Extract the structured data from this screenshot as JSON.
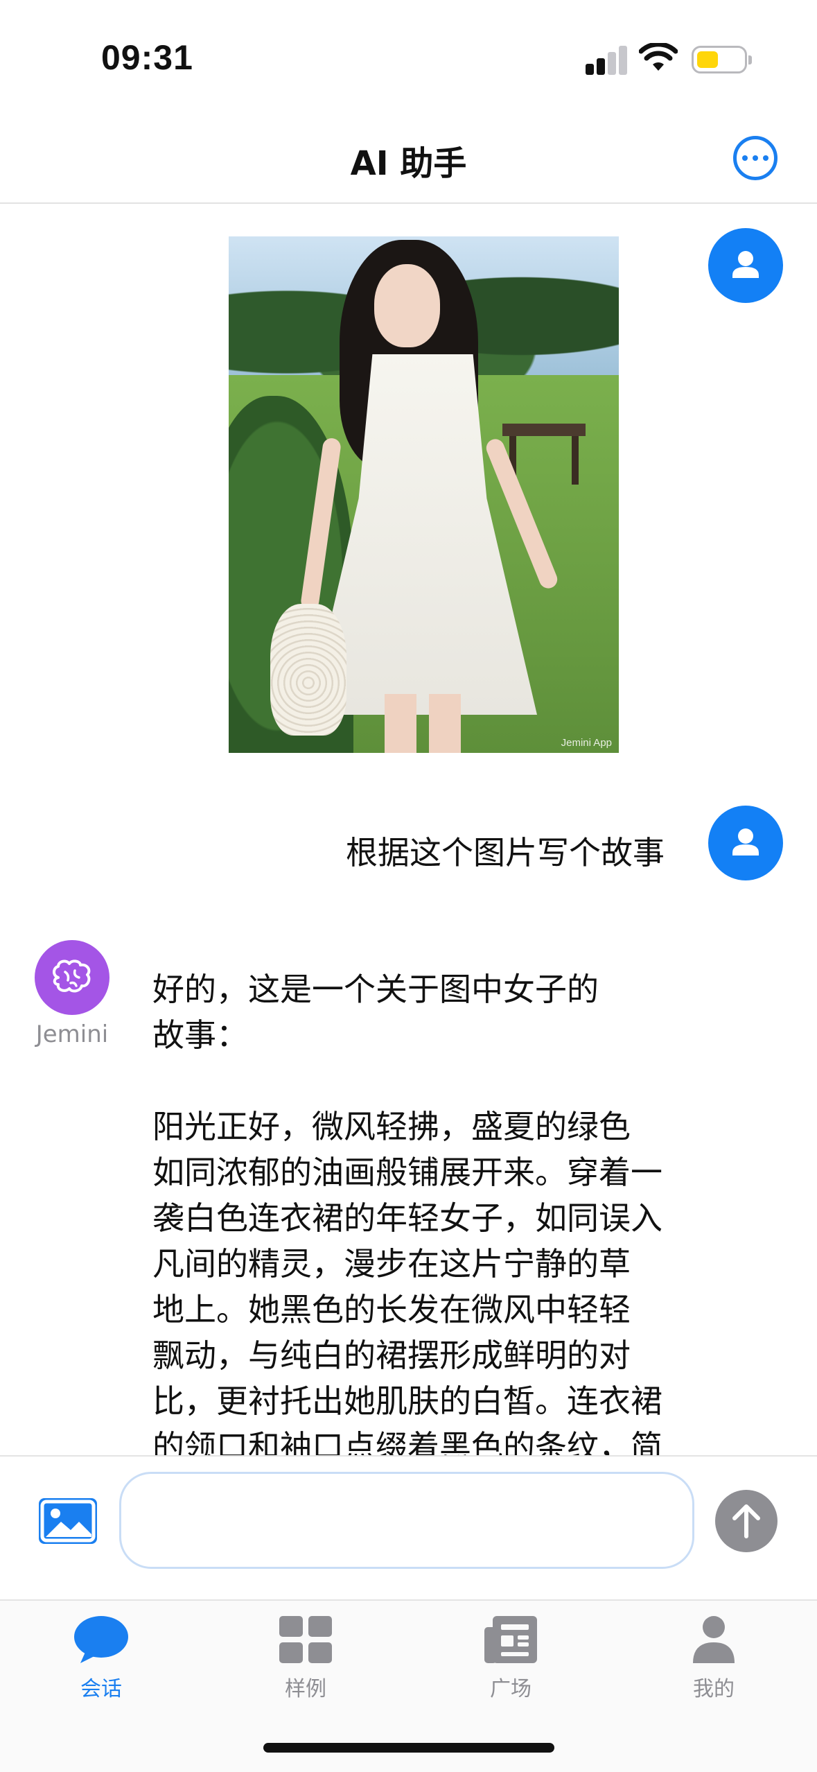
{
  "status_bar": {
    "time": "09:31",
    "signal_icon": "cellular-signal-icon",
    "wifi_icon": "wifi-icon",
    "battery_icon": "battery-icon",
    "battery_color": "#ffd60a"
  },
  "nav": {
    "title": "AI 助手",
    "more_icon": "ellipsis-circle-icon"
  },
  "conversation": {
    "user_image_watermark": "Jemini App",
    "user_message": "根据这个图片写个故事",
    "bot_name": "Jemini",
    "bot_paragraphs": [
      "好的，这是一个关于图中女子的\n故事：",
      "阳光正好，微风轻拂，盛夏的绿色\n如同浓郁的油画般铺展开来。穿着一\n袭白色连衣裙的年轻女子，如同误入\n凡间的精灵，漫步在这片宁静的草\n地上。她黑色的长发在微风中轻轻\n飘动，与纯白的裙摆形成鲜明的对\n比，更衬托出她肌肤的白皙。连衣裙\n的领口和袖口点缀着黑色的条纹，简"
    ]
  },
  "input": {
    "value": "",
    "placeholder": "",
    "image_icon": "image-icon",
    "send_icon": "arrow-up-icon"
  },
  "tabs": [
    {
      "label": "会话",
      "icon": "chat-bubble-icon",
      "active": true
    },
    {
      "label": "样例",
      "icon": "grid-icon",
      "active": false
    },
    {
      "label": "广场",
      "icon": "newspaper-icon",
      "active": false
    },
    {
      "label": "我的",
      "icon": "person-icon",
      "active": false
    }
  ],
  "colors": {
    "accent": "#1a7ff0",
    "user_avatar": "#1380f5",
    "bot_avatar": "#a455e6",
    "inactive": "#8e8e93"
  }
}
